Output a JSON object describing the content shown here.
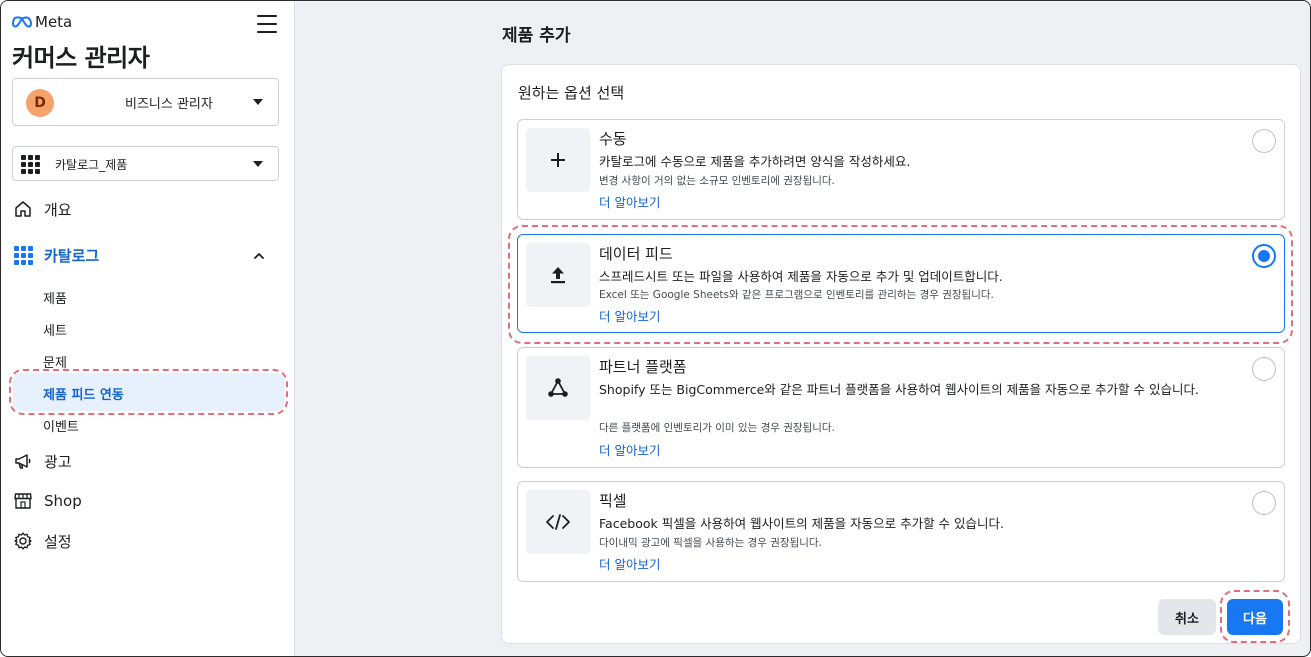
{
  "brand": {
    "logo_text": "Meta"
  },
  "sidebar": {
    "app_title": "커머스 관리자",
    "business_selector": {
      "avatar_letter": "D",
      "label": "비즈니스 관리자"
    },
    "catalog_selector": {
      "label": "카탈로그_제품"
    },
    "nav": {
      "overview": "개요",
      "catalog": "카탈로그",
      "catalog_sub": {
        "products": "제품",
        "sets": "세트",
        "issues": "문제",
        "product_feed": "제품 피드 연동",
        "events": "이벤트"
      },
      "ads": "광고",
      "shop": "Shop",
      "settings": "설정"
    }
  },
  "main": {
    "page_title": "제품 추가",
    "card_heading": "원하는 옵션 선택",
    "options": [
      {
        "title": "수동",
        "description": "카탈로그에 수동으로 제품을 추가하려면 양식을 작성하세요.",
        "note": "변경 사항이 거의 없는 소규모 인벤토리에 권장됩니다.",
        "link": "더 알아보기",
        "icon": "plus-icon",
        "selected": false
      },
      {
        "title": "데이터 피드",
        "description": "스프레드시트 또는 파일을 사용하여 제품을 자동으로 추가 및 업데이트합니다.",
        "note": "Excel 또는 Google Sheets와 같은 프로그램으로 인벤토리를 관리하는 경우 권장됩니다.",
        "link": "더 알아보기",
        "icon": "upload-icon",
        "selected": true
      },
      {
        "title": "파트너 플랫폼",
        "description": "Shopify 또는 BigCommerce와 같은 파트너 플랫폼을 사용하여 웹사이트의 제품을 자동으로 추가할 수 있습니다.",
        "note": "다른 플랫폼에 인벤토리가 이미 있는 경우 권장됩니다.",
        "link": "더 알아보기",
        "icon": "partner-network-icon",
        "selected": false
      },
      {
        "title": "픽셀",
        "description": "Facebook 픽셀을 사용하여 웹사이트의 제품을 자동으로 추가할 수 있습니다.",
        "note": "다이내믹 광고에 픽셀을 사용하는 경우 권장됩니다.",
        "link": "더 알아보기",
        "icon": "code-icon",
        "selected": false
      }
    ],
    "buttons": {
      "cancel": "취소",
      "next": "다음"
    }
  },
  "colors": {
    "accent": "#1877f2",
    "active_text": "#1464cc",
    "highlight_annotation": "#e26d7b",
    "avatar_bg": "#f5a26b"
  }
}
